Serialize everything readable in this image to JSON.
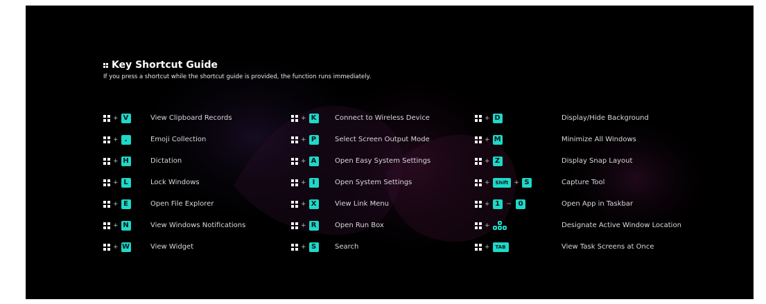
{
  "guide": {
    "title": "Key Shortcut Guide",
    "subtitle": "If you press a shortcut while the shortcut guide is provided, the function runs immediately."
  },
  "accent_color": "#1fd8c8",
  "columns": [
    {
      "shortcuts": [
        {
          "key": "V",
          "label": "View Clipboard Records"
        },
        {
          "key": ".",
          "label": "Emoji Collection"
        },
        {
          "key": "H",
          "label": "Dictation"
        },
        {
          "key": "L",
          "label": "Lock Windows"
        },
        {
          "key": "E",
          "label": "Open File Explorer"
        },
        {
          "key": "N",
          "label": "View Windows Notifications"
        },
        {
          "key": "W",
          "label": "View Widget"
        }
      ]
    },
    {
      "shortcuts": [
        {
          "key": "K",
          "label": "Connect to Wireless Device"
        },
        {
          "key": "P",
          "label": "Select Screen Output Mode"
        },
        {
          "key": "A",
          "label": "Open Easy System Settings"
        },
        {
          "key": "I",
          "label": "Open System Settings"
        },
        {
          "key": "X",
          "label": "View Link Menu"
        },
        {
          "key": "R",
          "label": "Open Run Box"
        },
        {
          "key": "S",
          "label": "Search"
        }
      ]
    },
    {
      "shortcuts": [
        {
          "key": "D",
          "label": "Display/Hide Background"
        },
        {
          "key": "M",
          "label": "Minimize All Windows"
        },
        {
          "key": "Z",
          "label": "Display Snap Layout"
        },
        {
          "key": "Shift",
          "key2": "S",
          "label": "Capture Tool"
        },
        {
          "key": "1",
          "key2": "0",
          "label": "Open App in Taskbar"
        },
        {
          "key": "snap-layout-icon",
          "label": "Designate Active Window Location"
        },
        {
          "key": "TAB",
          "label": "View Task Screens at Once"
        }
      ]
    }
  ],
  "symbols": {
    "plus": "+",
    "tilde": "~"
  }
}
